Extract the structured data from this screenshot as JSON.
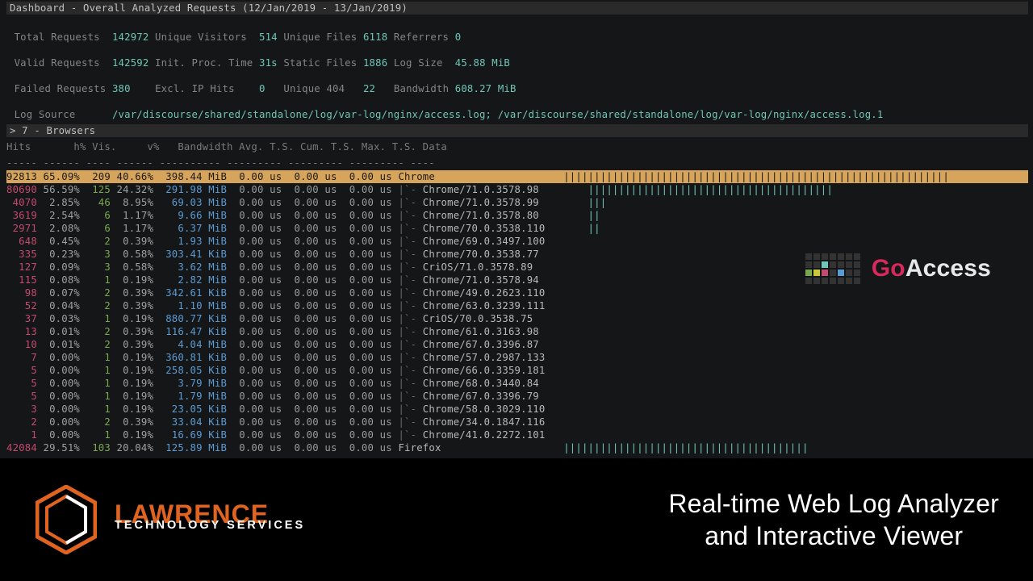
{
  "header": {
    "title": "Dashboard - Overall Analyzed Requests (12/Jan/2019 - 13/Jan/2019)"
  },
  "stats": {
    "total_requests_lbl": "Total Requests",
    "total_requests": "142972",
    "unique_visitors_lbl": "Unique Visitors",
    "unique_visitors": "514",
    "unique_files_lbl": "Unique Files",
    "unique_files": "6118",
    "referrers_lbl": "Referrers",
    "referrers": "0",
    "valid_requests_lbl": "Valid Requests",
    "valid_requests": "142592",
    "init_proc_lbl": "Init. Proc. Time",
    "init_proc": "31s",
    "static_files_lbl": "Static Files",
    "static_files": "1886",
    "log_size_lbl": "Log Size",
    "log_size": "45.88 MiB",
    "failed_requests_lbl": "Failed Requests",
    "failed_requests": "380",
    "excl_ip_lbl": "Excl. IP Hits",
    "excl_ip": "0",
    "unique_404_lbl": "Unique 404",
    "unique_404": "22",
    "bandwidth_lbl": "Bandwidth",
    "bandwidth": "608.27 MiB",
    "log_source_lbl": "Log Source",
    "log_source": "/var/discourse/shared/standalone/log/var-log/nginx/access.log; /var/discourse/shared/standalone/log/var-log/nginx/access.log.1"
  },
  "section": {
    "label": "> 7 - Browsers"
  },
  "columns": {
    "hits": "Hits",
    "hpct": "h%",
    "vis": "Vis.",
    "vpct": "v%",
    "bw": "Bandwidth",
    "avg": "Avg. T.S.",
    "cum": "Cum. T.S.",
    "max": "Max. T.S.",
    "data": "Data"
  },
  "rows": [
    {
      "hits": "92813",
      "hp": "65.09%",
      "vis": "209",
      "vp": "40.66%",
      "bw": "398.44 MiB",
      "avg": "0.00 us",
      "cum": "0.00 us",
      "max": "0.00 us",
      "data": "Chrome",
      "sel": true,
      "bar": 63
    },
    {
      "hits": "80690",
      "hp": "56.59%",
      "vis": "125",
      "vp": "24.32%",
      "bw": "291.98 MiB",
      "avg": "0.00 us",
      "cum": "0.00 us",
      "max": "0.00 us",
      "data": "|`- Chrome/71.0.3578.98",
      "bar": 40
    },
    {
      "hits": "4070",
      "hp": "2.85%",
      "vis": "46",
      "vp": "8.95%",
      "bw": "69.03 MiB",
      "avg": "0.00 us",
      "cum": "0.00 us",
      "max": "0.00 us",
      "data": "|`- Chrome/71.0.3578.99",
      "bar": 3
    },
    {
      "hits": "3619",
      "hp": "2.54%",
      "vis": "6",
      "vp": "1.17%",
      "bw": "9.66 MiB",
      "avg": "0.00 us",
      "cum": "0.00 us",
      "max": "0.00 us",
      "data": "|`- Chrome/71.0.3578.80",
      "bar": 2
    },
    {
      "hits": "2971",
      "hp": "2.08%",
      "vis": "6",
      "vp": "1.17%",
      "bw": "6.37 MiB",
      "avg": "0.00 us",
      "cum": "0.00 us",
      "max": "0.00 us",
      "data": "|`- Chrome/70.0.3538.110",
      "bar": 2
    },
    {
      "hits": "648",
      "hp": "0.45%",
      "vis": "2",
      "vp": "0.39%",
      "bw": "1.93 MiB",
      "avg": "0.00 us",
      "cum": "0.00 us",
      "max": "0.00 us",
      "data": "|`- Chrome/69.0.3497.100",
      "bar": 0
    },
    {
      "hits": "335",
      "hp": "0.23%",
      "vis": "3",
      "vp": "0.58%",
      "bw": "303.41 KiB",
      "avg": "0.00 us",
      "cum": "0.00 us",
      "max": "0.00 us",
      "data": "|`- Chrome/70.0.3538.77",
      "bar": 0
    },
    {
      "hits": "127",
      "hp": "0.09%",
      "vis": "3",
      "vp": "0.58%",
      "bw": "3.62 MiB",
      "avg": "0.00 us",
      "cum": "0.00 us",
      "max": "0.00 us",
      "data": "|`- CriOS/71.0.3578.89",
      "bar": 0
    },
    {
      "hits": "115",
      "hp": "0.08%",
      "vis": "1",
      "vp": "0.19%",
      "bw": "2.82 MiB",
      "avg": "0.00 us",
      "cum": "0.00 us",
      "max": "0.00 us",
      "data": "|`- Chrome/71.0.3578.94",
      "bar": 0
    },
    {
      "hits": "98",
      "hp": "0.07%",
      "vis": "2",
      "vp": "0.39%",
      "bw": "342.61 KiB",
      "avg": "0.00 us",
      "cum": "0.00 us",
      "max": "0.00 us",
      "data": "|`- Chrome/49.0.2623.110",
      "bar": 0
    },
    {
      "hits": "52",
      "hp": "0.04%",
      "vis": "2",
      "vp": "0.39%",
      "bw": "1.10 MiB",
      "avg": "0.00 us",
      "cum": "0.00 us",
      "max": "0.00 us",
      "data": "|`- Chrome/63.0.3239.111",
      "bar": 0
    },
    {
      "hits": "37",
      "hp": "0.03%",
      "vis": "1",
      "vp": "0.19%",
      "bw": "880.77 KiB",
      "avg": "0.00 us",
      "cum": "0.00 us",
      "max": "0.00 us",
      "data": "|`- CriOS/70.0.3538.75",
      "bar": 0
    },
    {
      "hits": "13",
      "hp": "0.01%",
      "vis": "2",
      "vp": "0.39%",
      "bw": "116.47 KiB",
      "avg": "0.00 us",
      "cum": "0.00 us",
      "max": "0.00 us",
      "data": "|`- Chrome/61.0.3163.98",
      "bar": 0
    },
    {
      "hits": "10",
      "hp": "0.01%",
      "vis": "2",
      "vp": "0.39%",
      "bw": "4.04 MiB",
      "avg": "0.00 us",
      "cum": "0.00 us",
      "max": "0.00 us",
      "data": "|`- Chrome/67.0.3396.87",
      "bar": 0
    },
    {
      "hits": "7",
      "hp": "0.00%",
      "vis": "1",
      "vp": "0.19%",
      "bw": "360.81 KiB",
      "avg": "0.00 us",
      "cum": "0.00 us",
      "max": "0.00 us",
      "data": "|`- Chrome/57.0.2987.133",
      "bar": 0
    },
    {
      "hits": "5",
      "hp": "0.00%",
      "vis": "1",
      "vp": "0.19%",
      "bw": "258.05 KiB",
      "avg": "0.00 us",
      "cum": "0.00 us",
      "max": "0.00 us",
      "data": "|`- Chrome/66.0.3359.181",
      "bar": 0
    },
    {
      "hits": "5",
      "hp": "0.00%",
      "vis": "1",
      "vp": "0.19%",
      "bw": "3.79 MiB",
      "avg": "0.00 us",
      "cum": "0.00 us",
      "max": "0.00 us",
      "data": "|`- Chrome/68.0.3440.84",
      "bar": 0
    },
    {
      "hits": "5",
      "hp": "0.00%",
      "vis": "1",
      "vp": "0.19%",
      "bw": "1.79 MiB",
      "avg": "0.00 us",
      "cum": "0.00 us",
      "max": "0.00 us",
      "data": "|`- Chrome/67.0.3396.79",
      "bar": 0
    },
    {
      "hits": "3",
      "hp": "0.00%",
      "vis": "1",
      "vp": "0.19%",
      "bw": "23.05 KiB",
      "avg": "0.00 us",
      "cum": "0.00 us",
      "max": "0.00 us",
      "data": "|`- Chrome/58.0.3029.110",
      "bar": 0
    },
    {
      "hits": "2",
      "hp": "0.00%",
      "vis": "2",
      "vp": "0.39%",
      "bw": "33.04 KiB",
      "avg": "0.00 us",
      "cum": "0.00 us",
      "max": "0.00 us",
      "data": "|`- Chrome/34.0.1847.116",
      "bar": 0
    },
    {
      "hits": "1",
      "hp": "0.00%",
      "vis": "1",
      "vp": "0.19%",
      "bw": "16.69 KiB",
      "avg": "0.00 us",
      "cum": "0.00 us",
      "max": "0.00 us",
      "data": "|`- Chrome/41.0.2272.101",
      "bar": 0
    },
    {
      "hits": "42084",
      "hp": "29.51%",
      "vis": "103",
      "vp": "20.04%",
      "bw": "125.89 MiB",
      "avg": "0.00 us",
      "cum": "0.00 us",
      "max": "0.00 us",
      "data": "Firefox",
      "bar": 40
    }
  ],
  "goaccess": {
    "go": "Go",
    "access": "Access"
  },
  "lawrence": {
    "main": "LAWRENCE",
    "sub": "TECHNOLOGY SERVICES"
  },
  "tagline": {
    "l1": "Real-time Web Log Analyzer",
    "l2": "and Interactive Viewer"
  },
  "colors": {
    "go": "#d6295d",
    "access": "#e8e8e8",
    "orange": "#e0641f"
  },
  "logo_grid": [
    [
      "#333",
      "#333",
      "#333",
      "#333",
      "#333",
      "#333",
      "#333"
    ],
    [
      "#333",
      "#333",
      "#6ec5b8",
      "#333",
      "#333",
      "#333",
      "#333"
    ],
    [
      "#7aa84f",
      "#c9c93a",
      "#c44a6e",
      "#333",
      "#5a9bd4",
      "#333",
      "#333"
    ],
    [
      "#333",
      "#333",
      "#333",
      "#333",
      "#333",
      "#333",
      "#333"
    ]
  ]
}
